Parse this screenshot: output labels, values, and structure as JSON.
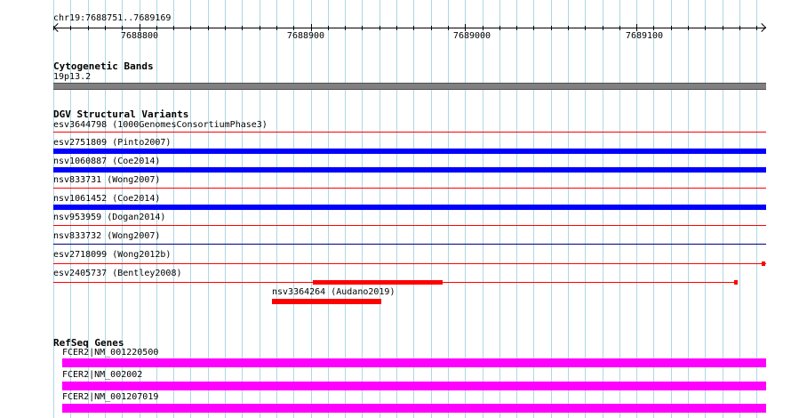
{
  "ruler": {
    "position": "chr19:7688751..7689169",
    "tick_labels": [
      "7688800",
      "7688900",
      "7689000",
      "7689100"
    ]
  },
  "colors": {
    "grid": "#ADD8E6",
    "cytoband": "#808080",
    "dgv_gain": "#0000FF",
    "dgv_loss": "#FF0000",
    "refseq": "#FF00FF"
  },
  "cytogenetic_bands": {
    "title": "Cytogenetic Bands",
    "band_label": "19p13.2"
  },
  "dgv": {
    "title": "DGV Structural Variants",
    "variants": [
      {
        "label": "esv3644798 (1000GenomesConsortiumPhase3)",
        "type": "loss"
      },
      {
        "label": "esv2751809 (Pinto2007)",
        "type": "gain"
      },
      {
        "label": "nsv1060887 (Coe2014)",
        "type": "gain"
      },
      {
        "label": "nsv833731 (Wong2007)",
        "type": "loss"
      },
      {
        "label": "nsv1061452 (Coe2014)",
        "type": "gain"
      },
      {
        "label": "nsv953959 (Dogan2014)",
        "type": "loss"
      },
      {
        "label": "nsv833732 (Wong2007)",
        "type": "gain"
      },
      {
        "label": "esv2718099 (Wong2012b)",
        "type": "loss"
      },
      {
        "label": "esv2405737 (Bentley2008)",
        "type": "loss"
      },
      {
        "label": "nsv3364264 (Audano2019)",
        "type": "loss"
      }
    ]
  },
  "refseq": {
    "title": "RefSeq Genes",
    "genes": [
      {
        "label": "FCER2|NM_001220500"
      },
      {
        "label": "FCER2|NM_002002"
      },
      {
        "label": "FCER2|NM_001207019"
      }
    ]
  }
}
